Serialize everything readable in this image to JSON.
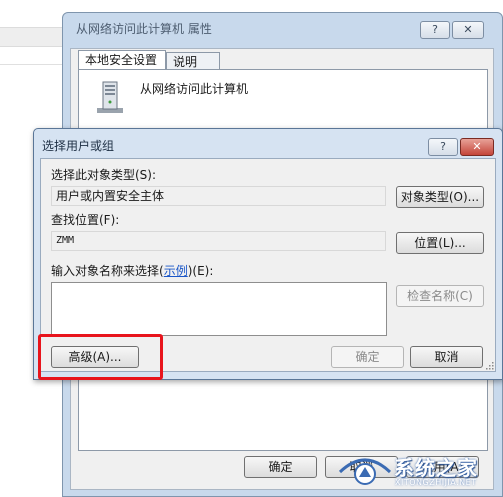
{
  "background_dialog": {
    "title": "从网络访问此计算机 属性",
    "help_glyph": "?",
    "close_glyph": "✕",
    "tabs": [
      {
        "label": "本地安全设置",
        "active": true
      },
      {
        "label": "说明",
        "active": false
      }
    ],
    "policy_name": "从网络访问此计算机",
    "policy_icon": "server-icon",
    "buttons": {
      "ok": "确定",
      "cancel": "取消",
      "apply": "应用(A)"
    }
  },
  "foreground_dialog": {
    "title": "选择用户或组",
    "help_glyph": "?",
    "close_glyph": "✕",
    "object_type": {
      "label": "选择此对象类型(S):",
      "value": "用户或内置安全主体",
      "button": "对象类型(O)..."
    },
    "location": {
      "label": "查找位置(F):",
      "value": "ZMM",
      "button": "位置(L)..."
    },
    "enter_names": {
      "label_prefix": "输入对象名称来选择(",
      "label_link": "示例",
      "label_suffix": ")(E):",
      "value": ""
    },
    "buttons": {
      "check_names": "检查名称(C)",
      "advanced": "高级(A)...",
      "ok": "确定",
      "cancel": "取消"
    }
  },
  "watermark": {
    "text": "系统之家",
    "url": "XITONGZHIJIA.NET"
  },
  "colors": {
    "highlight": "#e8141c",
    "title_bar": "#d6e3f2",
    "link": "#1a56c8",
    "close_button": "#c4453a"
  }
}
